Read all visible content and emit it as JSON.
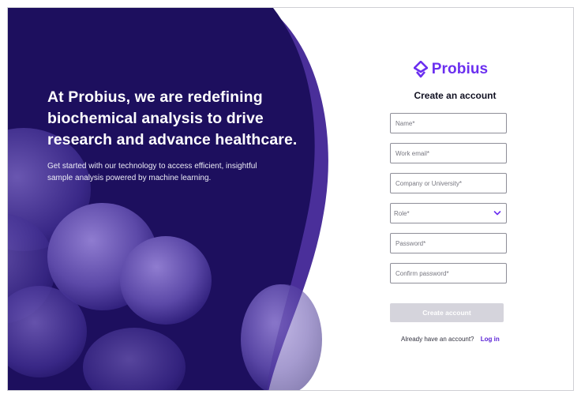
{
  "hero": {
    "title": "At Probius, we are redefining biochemical analysis to drive research and advance healthcare.",
    "subtitle": "Get started with our technology to access efficient, insightful sample analysis powered by machine learning."
  },
  "brand": {
    "name": "Probius",
    "logo_icon": "probius-logo-icon",
    "accent_color": "#6b2ff0",
    "hero_color": "#1d0f5e"
  },
  "form": {
    "title": "Create an account",
    "name_placeholder": "Name*",
    "email_placeholder": "Work email*",
    "company_placeholder": "Company or University*",
    "role_label": "Role*",
    "role_icon": "chevron-down-icon",
    "password_placeholder": "Password*",
    "confirm_password_placeholder": "Confirm password*",
    "submit_label": "Create account",
    "login_prompt": "Already have an account?",
    "login_link": "Log in"
  }
}
